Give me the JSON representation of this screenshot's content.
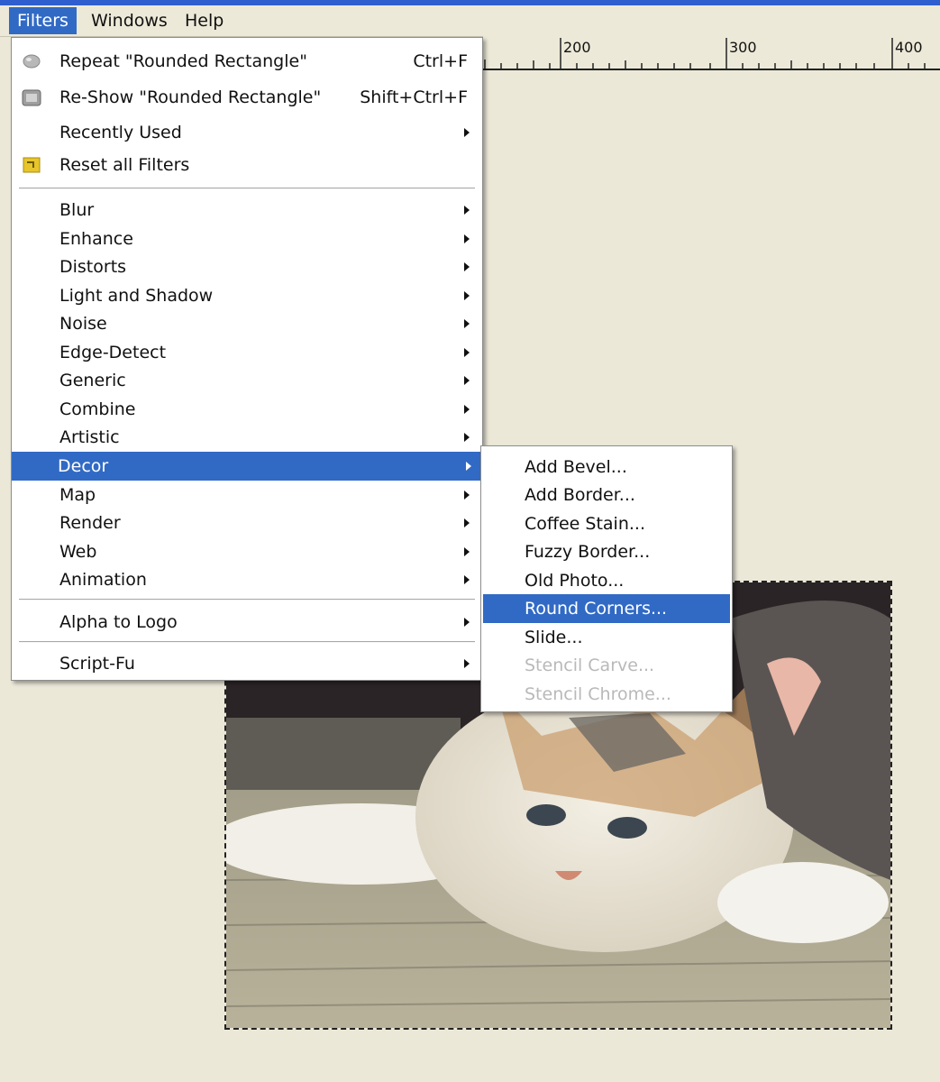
{
  "menubar": {
    "items": [
      {
        "label": "Filters",
        "active": true
      },
      {
        "label": "Windows",
        "active": false
      },
      {
        "label": "Help",
        "active": false
      }
    ]
  },
  "ruler": {
    "labels": [
      "200",
      "300",
      "400"
    ]
  },
  "filters_menu": {
    "items": [
      {
        "label": "Repeat \"Rounded Rectangle\"",
        "shortcut": "Ctrl+F",
        "icon": "repeat-filter-icon"
      },
      {
        "label": "Re-Show \"Rounded Rectangle\"",
        "shortcut": "Shift+Ctrl+F",
        "icon": "reshow-filter-icon"
      },
      {
        "label": "Recently Used",
        "submenu": true
      },
      {
        "label": "Reset all Filters",
        "icon": "reset-filters-icon"
      },
      {
        "label": "Blur",
        "submenu": true
      },
      {
        "label": "Enhance",
        "submenu": true
      },
      {
        "label": "Distorts",
        "submenu": true
      },
      {
        "label": "Light and Shadow",
        "submenu": true
      },
      {
        "label": "Noise",
        "submenu": true
      },
      {
        "label": "Edge-Detect",
        "submenu": true
      },
      {
        "label": "Generic",
        "submenu": true
      },
      {
        "label": "Combine",
        "submenu": true
      },
      {
        "label": "Artistic",
        "submenu": true
      },
      {
        "label": "Decor",
        "submenu": true,
        "highlighted": true
      },
      {
        "label": "Map",
        "submenu": true
      },
      {
        "label": "Render",
        "submenu": true
      },
      {
        "label": "Web",
        "submenu": true
      },
      {
        "label": "Animation",
        "submenu": true
      },
      {
        "label": "Alpha to Logo",
        "submenu": true
      },
      {
        "label": "Script-Fu",
        "submenu": true
      }
    ]
  },
  "decor_submenu": {
    "items": [
      {
        "label": "Add Bevel..."
      },
      {
        "label": "Add Border..."
      },
      {
        "label": "Coffee Stain..."
      },
      {
        "label": "Fuzzy Border..."
      },
      {
        "label": "Old Photo..."
      },
      {
        "label": "Round Corners...",
        "highlighted": true
      },
      {
        "label": "Slide..."
      },
      {
        "label": "Stencil Carve...",
        "disabled": true
      },
      {
        "label": "Stencil Chrome...",
        "disabled": true
      }
    ]
  },
  "colors": {
    "accent": "#316ac5",
    "canvas": "#ebe8d8",
    "titlebar": "#2f5fcf"
  }
}
